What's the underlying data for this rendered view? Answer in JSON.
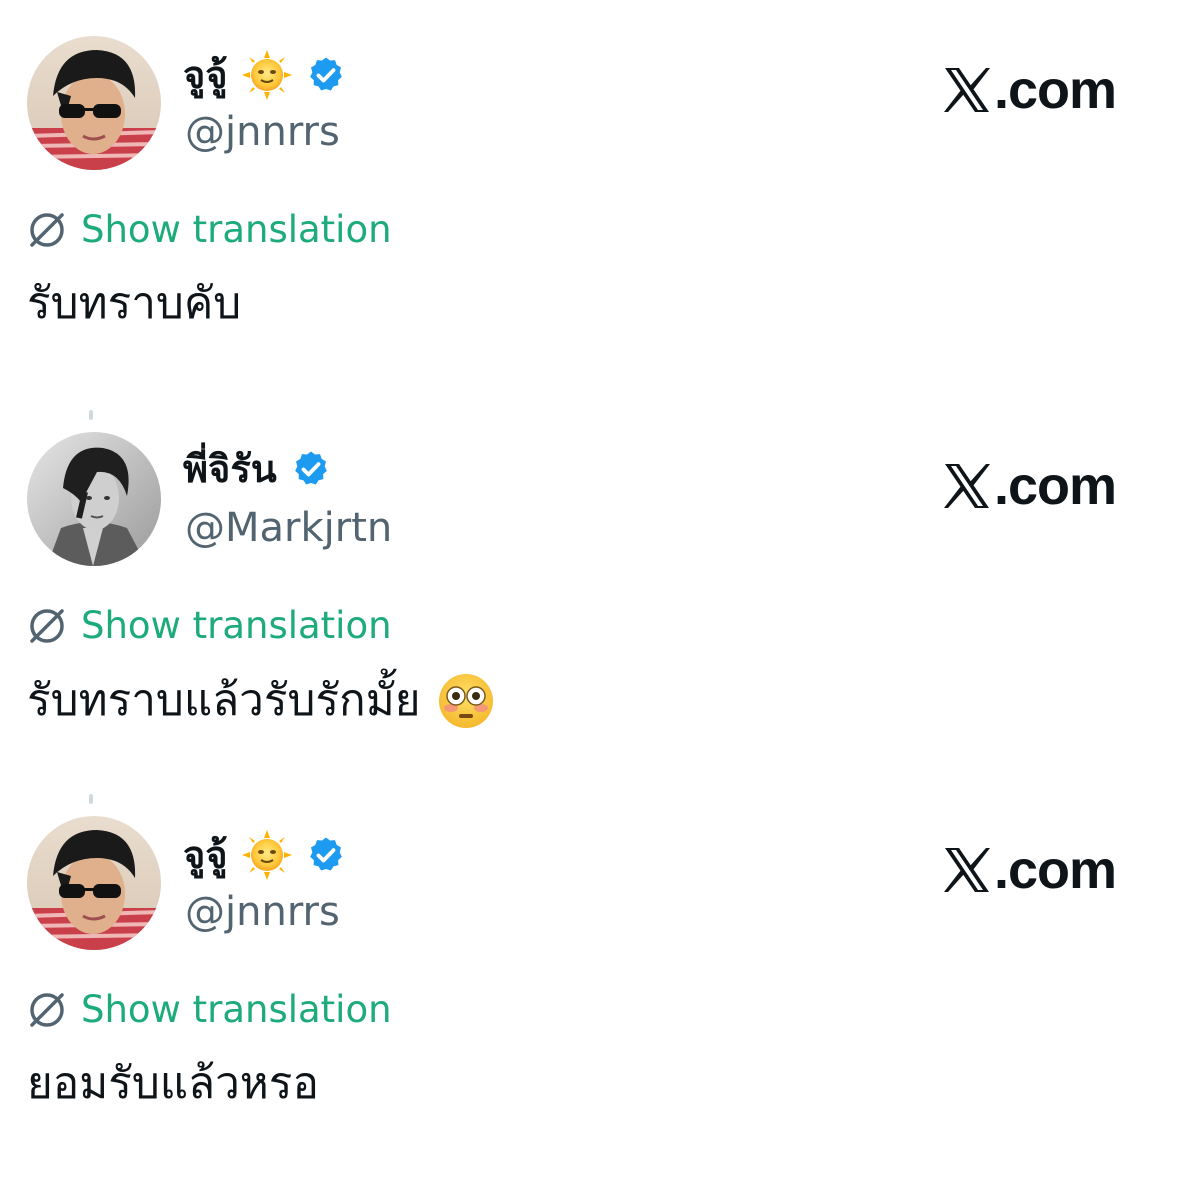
{
  "tweets": [
    {
      "display_name": "จูจู้",
      "handle": "@jnnrrs",
      "name_emoji": "sun-with-face-icon",
      "verified": true,
      "brand": ".com",
      "translate_label": "Show translation",
      "text": "รับทราบคับ",
      "text_emoji": null
    },
    {
      "display_name": "พี่จิรัน",
      "handle": "@Markjrtn",
      "name_emoji": null,
      "verified": true,
      "brand": ".com",
      "translate_label": "Show translation",
      "text": "รับทราบแล้วรับรักมั้ย",
      "text_emoji": "flushed-face-icon"
    },
    {
      "display_name": "จูจู้",
      "handle": "@jnnrrs",
      "name_emoji": "sun-with-face-icon",
      "verified": true,
      "brand": ".com",
      "translate_label": "Show translation",
      "text": "ยอมรับแล้วหรอ",
      "text_emoji": null
    }
  ],
  "colors": {
    "verified_blue": "#1d9bf0",
    "translate_green": "#1dab7a",
    "handle_gray": "#536471",
    "text": "#0f1419"
  }
}
